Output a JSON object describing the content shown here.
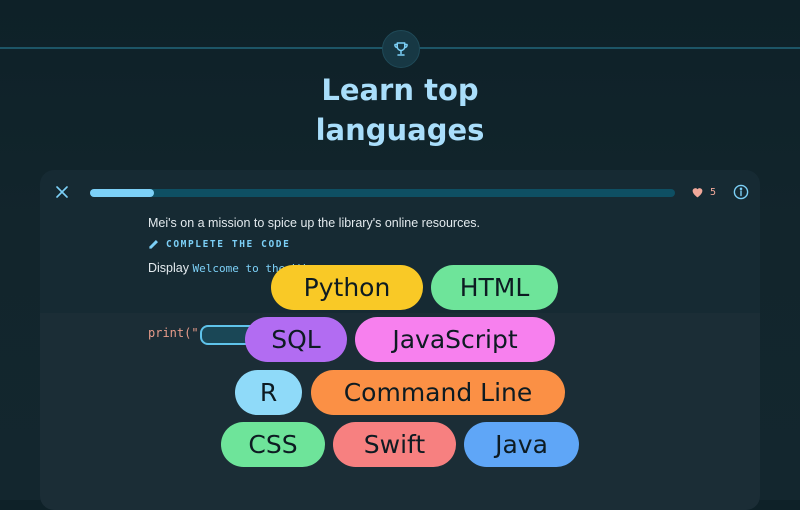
{
  "hero": {
    "title_line1": "Learn top",
    "title_line2": "languages"
  },
  "lesson": {
    "progress_fraction": 0.11,
    "hearts": "5",
    "mission_text": "Mei's on a mission to spice up the library's online resources.",
    "instruction_label": "COMPLETE THE CODE",
    "display_prefix": "Display ",
    "display_code": "Welcome to the LW",
    "code_prefix": "print(\""
  },
  "languages": [
    {
      "label": "Python",
      "color": "#f9c926"
    },
    {
      "label": "HTML",
      "color": "#6ee49a"
    },
    {
      "label": "SQL",
      "color": "#b26cf2"
    },
    {
      "label": "JavaScript",
      "color": "#f780ee"
    },
    {
      "label": "R",
      "color": "#8fdaf9"
    },
    {
      "label": "Command Line",
      "color": "#fb9045"
    },
    {
      "label": "CSS",
      "color": "#6ee49a"
    },
    {
      "label": "Swift",
      "color": "#f78080"
    },
    {
      "label": "Java",
      "color": "#5fa6f7"
    }
  ],
  "colors": {
    "accent": "#7cd0f7",
    "heart": "#f0a89a",
    "background": "#12252c"
  },
  "icons": {
    "badge": "trophy-icon",
    "close": "close-icon",
    "hearts": "heart-icon",
    "info": "info-icon",
    "instruction": "pencil-icon"
  }
}
